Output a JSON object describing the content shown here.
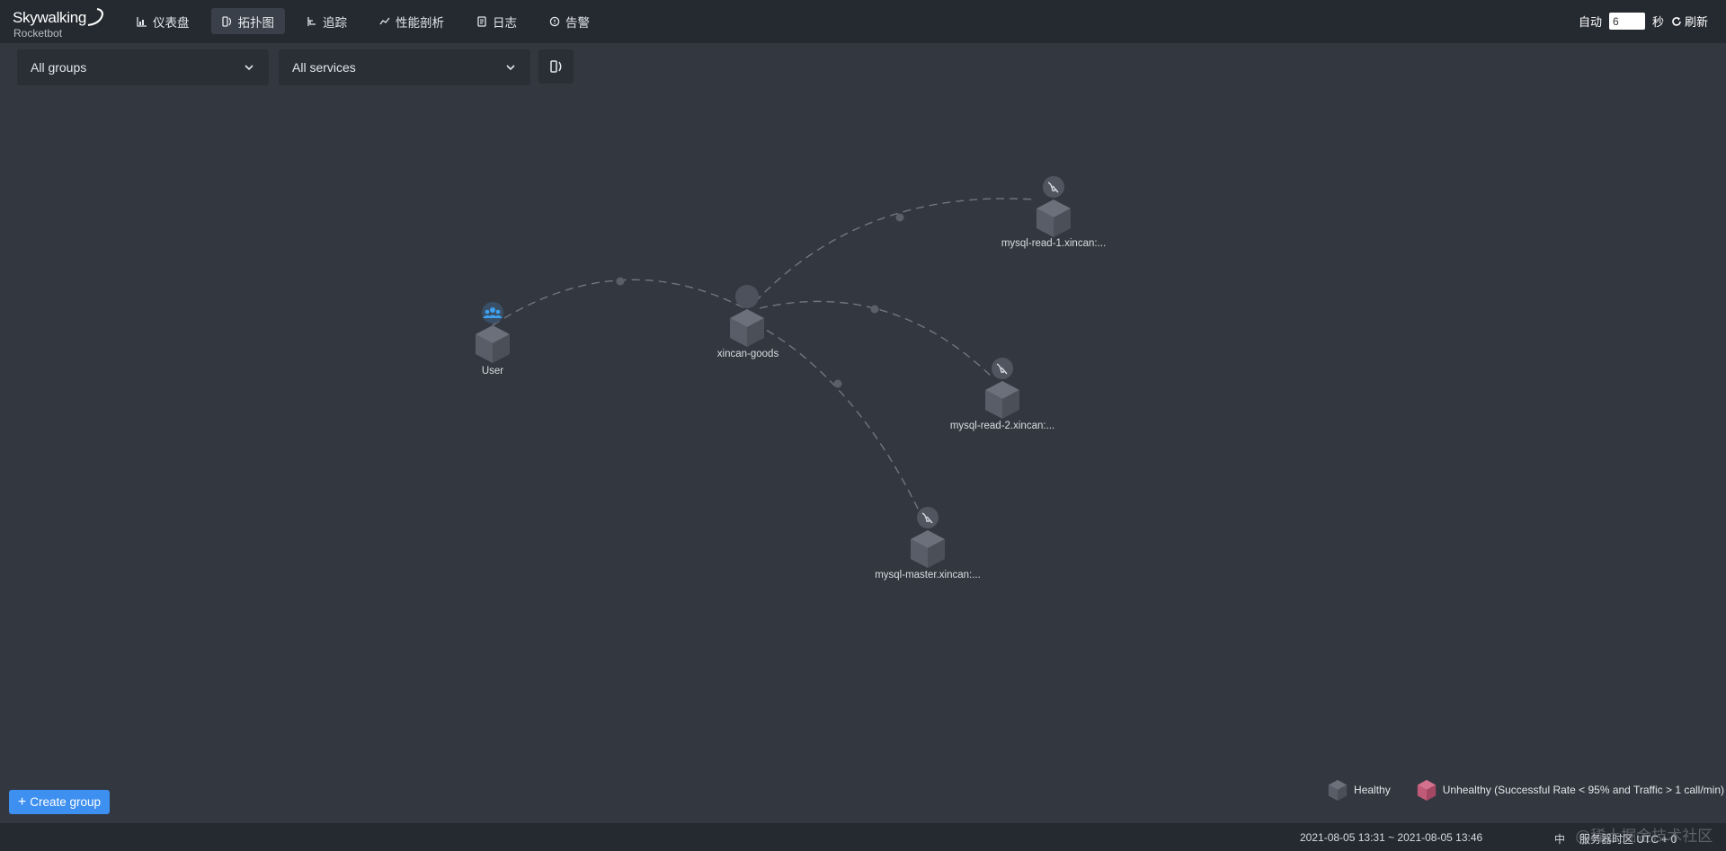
{
  "header": {
    "logo_main": "Skywalking",
    "logo_sub": "Rocketbot",
    "nav": [
      {
        "label": "仪表盘",
        "icon": "chart-icon",
        "active": false
      },
      {
        "label": "拓扑图",
        "icon": "topology-icon",
        "active": true
      },
      {
        "label": "追踪",
        "icon": "trace-icon",
        "active": false
      },
      {
        "label": "性能剖析",
        "icon": "profile-icon",
        "active": false
      },
      {
        "label": "日志",
        "icon": "log-icon",
        "active": false
      },
      {
        "label": "告警",
        "icon": "alarm-icon",
        "active": false
      }
    ],
    "auto_label": "自动",
    "auto_value": "6",
    "seconds_label": "秒",
    "refresh_label": "刷新"
  },
  "toolbar": {
    "group_select": "All groups",
    "service_select": "All services"
  },
  "topology": {
    "nodes": [
      {
        "id": "user",
        "label": "User",
        "type": "user-icon"
      },
      {
        "id": "goods",
        "label": "xincan-goods",
        "type": "service-icon"
      },
      {
        "id": "read1",
        "label": "mysql-read-1.xincan:...",
        "type": "mysql-icon"
      },
      {
        "id": "read2",
        "label": "mysql-read-2.xincan:...",
        "type": "mysql-icon"
      },
      {
        "id": "master",
        "label": "mysql-master.xincan:...",
        "type": "mysql-icon"
      }
    ],
    "edges": [
      {
        "from": "user",
        "to": "goods"
      },
      {
        "from": "goods",
        "to": "read1"
      },
      {
        "from": "goods",
        "to": "read2"
      },
      {
        "from": "goods",
        "to": "master"
      }
    ]
  },
  "create_group_label": "Create group",
  "legend": {
    "healthy": "Healthy",
    "unhealthy": "Unhealthy (Successful Rate < 95% and Traffic > 1 call/min)",
    "healthy_color": "#5b606b",
    "unhealthy_color": "#c05a78"
  },
  "footer": {
    "time_range": "2021-08-05 13:31 ~ 2021-08-05 13:46",
    "lang": "中",
    "timezone": "服务器时区 UTC + 0"
  },
  "watermark": "@稀土掘金技术社区"
}
